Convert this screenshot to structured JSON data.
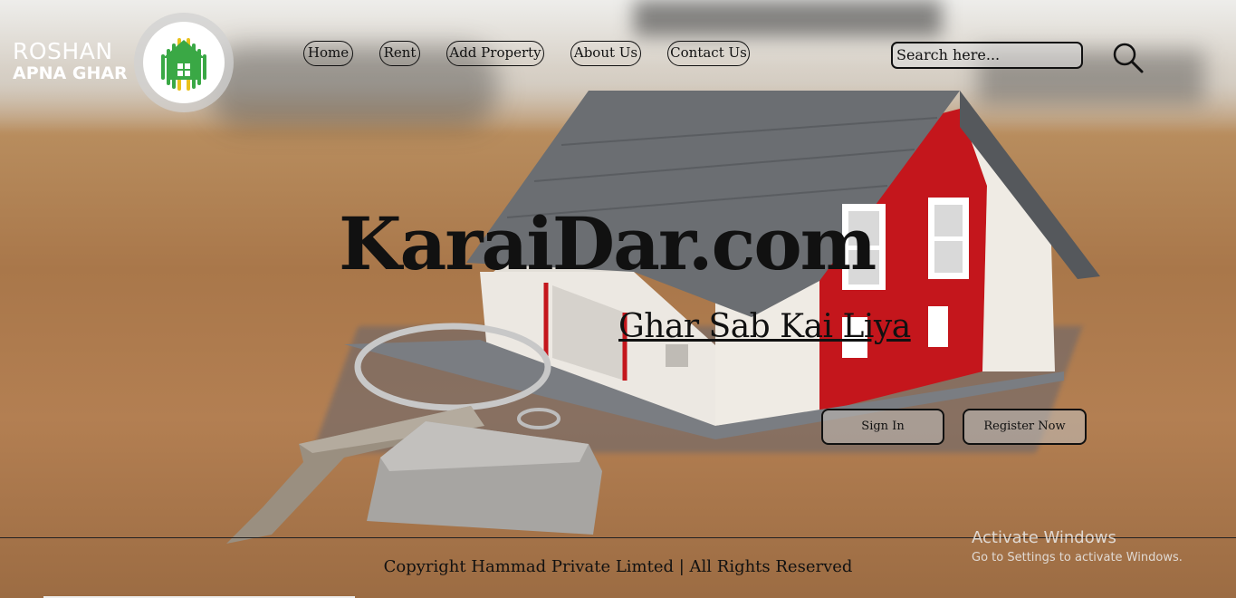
{
  "logo": {
    "line1": "ROSHAN",
    "line2": "APNA GHAR",
    "icon": "house-logo-icon"
  },
  "nav": {
    "items": [
      {
        "label": "Home"
      },
      {
        "label": "Rent"
      },
      {
        "label": "Add Property"
      },
      {
        "label": "About Us"
      },
      {
        "label": "Contact Us"
      }
    ]
  },
  "search": {
    "placeholder": "Search here...",
    "icon": "search-icon"
  },
  "hero": {
    "title": "KaraiDar.com",
    "subtitle": "Ghar Sab Kai Liya"
  },
  "actions": {
    "sign_in": "Sign In",
    "register": "Register Now"
  },
  "footer": {
    "copyright": "Copyright Hammad Private Limted | All Rights Reserved"
  },
  "watermark": {
    "title": "Activate Windows",
    "subtitle": "Go to Settings to activate Windows."
  },
  "colors": {
    "text": "#111111",
    "logo_green": "#3aa845",
    "house_red": "#c4161c",
    "roof_gray": "#6b6e72"
  }
}
